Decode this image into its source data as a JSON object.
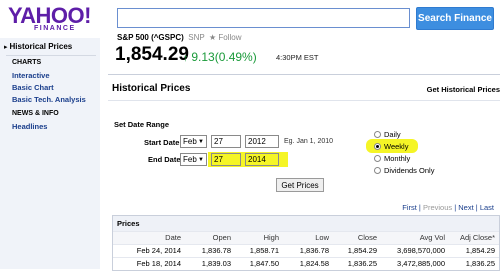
{
  "header": {
    "logo_text": "YAHOO!",
    "logo_sub": "FINANCE",
    "search_value": "",
    "search_button": "Search Finance"
  },
  "sidebar": {
    "current": "Historical Prices",
    "section_charts": "CHARTS",
    "links_charts": [
      "Interactive",
      "Basic Chart",
      "Basic Tech. Analysis"
    ],
    "section_news": "NEWS & INFO",
    "links_news": [
      "Headlines"
    ]
  },
  "quote": {
    "name_line": "S&P 500 (^GSPC)",
    "exchange": "SNP",
    "follow": "Follow",
    "price": "1,854.29",
    "change": "9.13(0.49%)",
    "time": "4:30PM EST"
  },
  "panel": {
    "title": "Historical Prices",
    "right_link": "Get Historical Prices",
    "set_date_range": "Set Date Range",
    "start_label": "Start Date:",
    "start_month": "Feb",
    "start_day": "27",
    "start_year": "2012",
    "example": "Eg. Jan 1, 2010",
    "end_label": "End Date:",
    "end_month": "Feb",
    "end_day": "27",
    "end_year": "2014",
    "radio_options": [
      "Daily",
      "Weekly",
      "Monthly",
      "Dividends Only"
    ],
    "radio_selected": "Weekly",
    "get_prices": "Get Prices",
    "pager": {
      "first": "First",
      "previous": "Previous",
      "next": "Next",
      "last": "Last"
    }
  },
  "table": {
    "title": "Prices",
    "columns": [
      "Date",
      "Open",
      "High",
      "Low",
      "Close",
      "Avg Vol",
      "Adj Close*"
    ],
    "rows": [
      [
        "Feb 24, 2014",
        "1,836.78",
        "1,858.71",
        "1,836.78",
        "1,854.29",
        "3,698,570,000",
        "1,854.29"
      ],
      [
        "Feb 18, 2014",
        "1,839.03",
        "1,847.50",
        "1,824.58",
        "1,836.25",
        "3,472,885,000",
        "1,836.25"
      ]
    ]
  },
  "colors": {
    "brand_purple": "#5e1ea8",
    "search_blue": "#3d8ee0",
    "positive_green": "#1a9a3a",
    "highlight_yellow": "#f5f526",
    "link_blue": "#1a3e8c"
  },
  "icons": {
    "up_arrow": "arrow-up-icon",
    "sidebar_arrow": "triangle-right-icon",
    "follow_star": "star-icon"
  }
}
